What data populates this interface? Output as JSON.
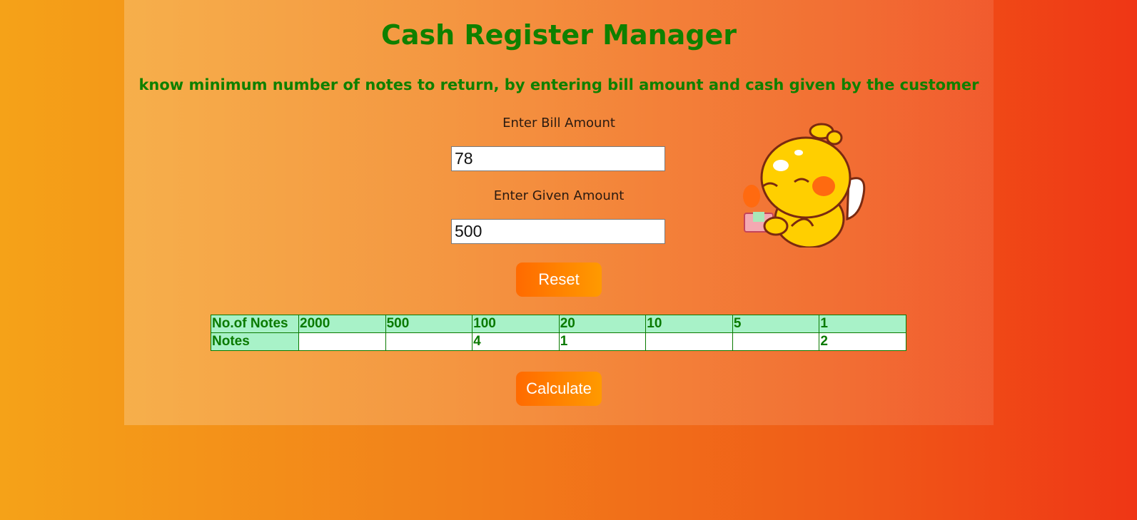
{
  "header": {
    "title": "Cash Register Manager",
    "subtitle": "know minimum number of notes to return, by entering bill amount and cash given by the customer"
  },
  "form": {
    "bill_label": "Enter Bill Amount",
    "bill_value": "78",
    "given_label": "Enter Given Amount",
    "given_value": "500",
    "reset_label": "Reset",
    "calculate_label": "Calculate"
  },
  "table": {
    "head_label": "No.of Notes",
    "denominations": [
      "2000",
      "500",
      "100",
      "20",
      "10",
      "5",
      "1"
    ],
    "row_label": "Notes",
    "counts": [
      "",
      "",
      "4",
      "1",
      "",
      "",
      "2"
    ]
  },
  "colors": {
    "heading": "#0f8000",
    "table_header_bg": "#a8f2c8",
    "button_gradient_start": "#ff6a00",
    "button_gradient_end": "#ff9a00"
  },
  "images": {
    "mascot": "yellow-chick-counting-money"
  }
}
